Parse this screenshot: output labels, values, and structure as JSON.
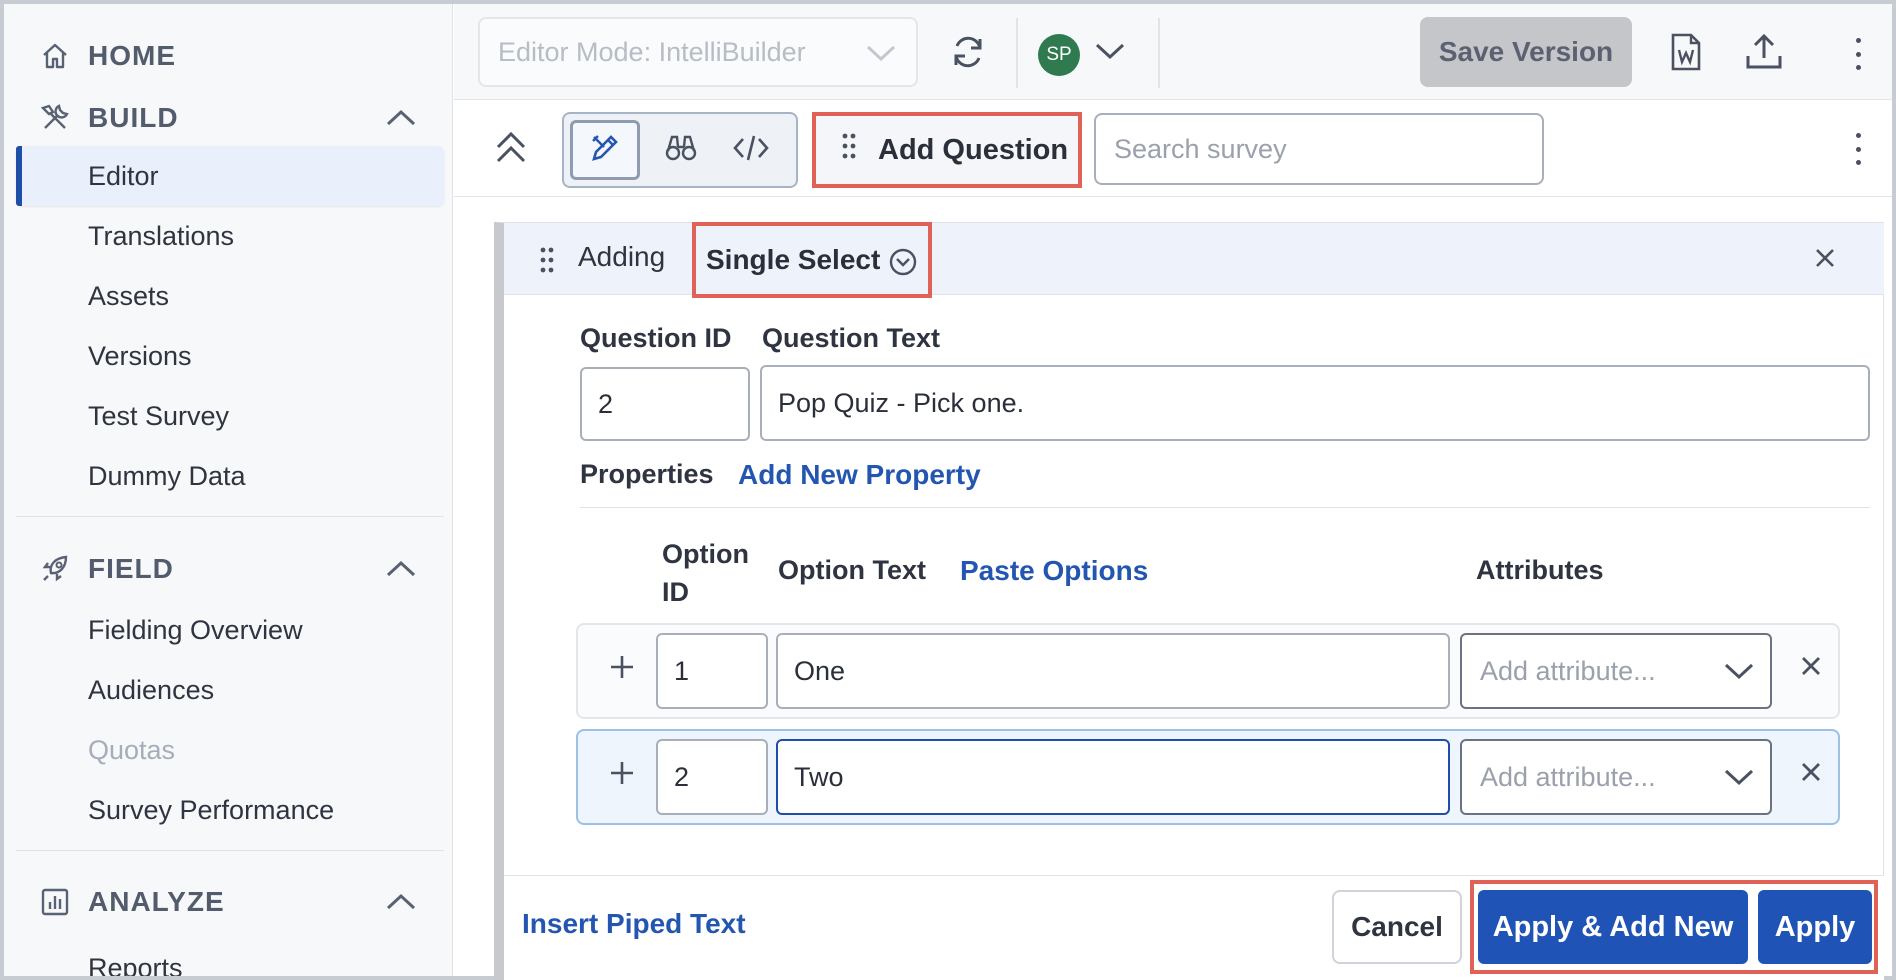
{
  "sidebar": {
    "build": {
      "home_label": "HOME",
      "section_label": "BUILD",
      "items": [
        "Editor",
        "Translations",
        "Assets",
        "Versions",
        "Test Survey",
        "Dummy Data"
      ],
      "active_item": "Editor"
    },
    "field": {
      "section_label": "FIELD",
      "items": [
        "Fielding Overview",
        "Audiences",
        "Quotas",
        "Survey Performance"
      ],
      "disabled_item": "Quotas"
    },
    "analyze": {
      "section_label": "ANALYZE",
      "items": [
        "Reports"
      ]
    }
  },
  "topbar": {
    "mode_select": "Editor Mode: IntelliBuilder",
    "avatar_initials": "SP",
    "avatar_color": "#2f7a4f",
    "save_version_label": "Save Version",
    "icons": [
      "refresh-icon",
      "word-doc-icon",
      "upload-icon",
      "more-vertical-icon"
    ]
  },
  "toolrow": {
    "add_question_label": "Add Question",
    "search_placeholder": "Search survey",
    "view_modes": [
      "edit-icon",
      "preview-binoculars-icon",
      "code-icon"
    ]
  },
  "editor": {
    "adding_label": "Adding",
    "question_type": "Single Select",
    "question_id_label": "Question ID",
    "question_id_value": "2",
    "question_text_label": "Question Text",
    "question_text_value": "Pop Quiz - Pick one.",
    "properties_label": "Properties",
    "add_property_link": "Add New Property",
    "options_header": {
      "option_id_label": "Option ID",
      "option_text_label": "Option Text",
      "paste_options_link": "Paste Options",
      "attributes_label": "Attributes"
    },
    "options": [
      {
        "id": "1",
        "text": "One",
        "attribute_placeholder": "Add attribute..."
      },
      {
        "id": "2",
        "text": "Two",
        "attribute_placeholder": "Add attribute..."
      }
    ],
    "footer": {
      "insert_piped_text": "Insert Piped Text",
      "cancel_label": "Cancel",
      "apply_add_new_label": "Apply & Add New",
      "apply_label": "Apply"
    }
  },
  "colors": {
    "primary": "#1f53b6",
    "link": "#2356b0",
    "highlight": "#e06257",
    "active_bar": "#1e4ea8"
  }
}
